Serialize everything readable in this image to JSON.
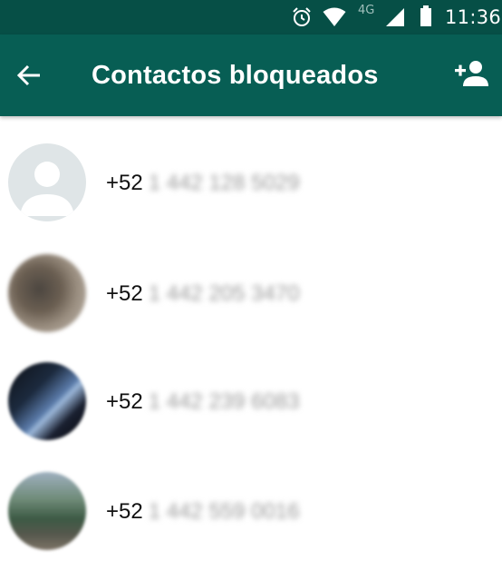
{
  "status_bar": {
    "time": "11:36",
    "network": "4G",
    "icons": [
      "alarm-icon",
      "wifi-icon",
      "signal-icon",
      "battery-icon"
    ]
  },
  "toolbar": {
    "title": "Contactos bloqueados",
    "back_icon": "arrow-left-icon",
    "add_icon": "add-contact-icon"
  },
  "contacts": [
    {
      "prefix": "+52",
      "number": "1 442 128 5029",
      "avatar": "default"
    },
    {
      "prefix": "+52",
      "number": "1 442 205 3470",
      "avatar": "photo"
    },
    {
      "prefix": "+52",
      "number": "1 442 239 6083",
      "avatar": "photo"
    },
    {
      "prefix": "+52",
      "number": "1 442 559 0016",
      "avatar": "photo"
    }
  ],
  "colors": {
    "status_bar": "#064f46",
    "toolbar": "#075e54",
    "text": "#111111"
  }
}
